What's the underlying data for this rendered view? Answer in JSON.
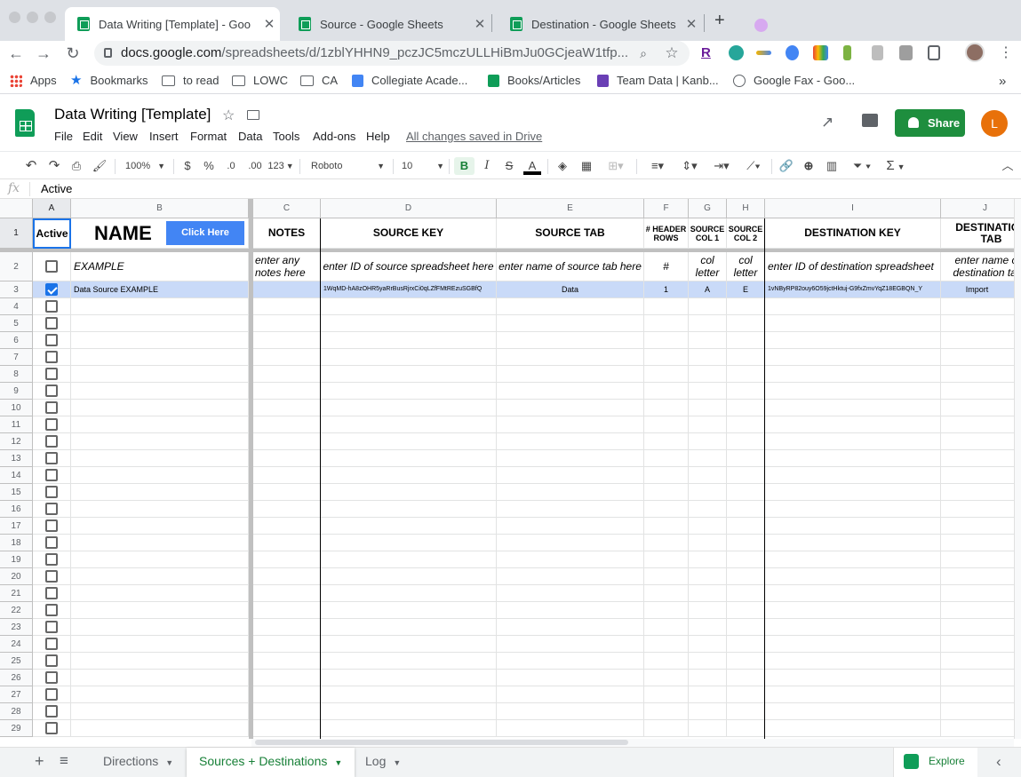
{
  "browser": {
    "tabs": [
      {
        "title": "Data Writing [Template] - Goo",
        "active": true
      },
      {
        "title": "Source - Google Sheets",
        "active": false
      },
      {
        "title": "Destination - Google Sheets",
        "active": false
      }
    ],
    "new_tab": "+",
    "close": "✕",
    "url_domain": "docs.google.com",
    "url_path": "/spreadsheets/d/1zblYHHN9_pczJC5mczULLHiBmJu0GCjeaW1tfp...",
    "bookmarks": [
      "Apps",
      "Bookmarks",
      "to read",
      "LOWC",
      "CA",
      "Collegiate Acade...",
      "Books/Articles",
      "Team Data | Kanb...",
      "Google Fax - Goo..."
    ],
    "bookmarks_more": "»",
    "ext_r_label": "R"
  },
  "app": {
    "title": "Data Writing [Template]",
    "menu": [
      "File",
      "Edit",
      "View",
      "Insert",
      "Format",
      "Data",
      "Tools",
      "Add-ons",
      "Help"
    ],
    "save_status": "All changes saved in Drive",
    "share_label": "Share",
    "avatar_initial": "L",
    "accent_color": "#1e8e3e"
  },
  "toolbar": {
    "zoom": "100%",
    "currency": "$",
    "percent": "%",
    "dec_less": ".0",
    "dec_more": ".00",
    "more_formats": "123",
    "font": "Roboto",
    "font_size": "10",
    "bold": "B",
    "italic": "I",
    "strike": "S",
    "text_color": "A",
    "sum": "Σ"
  },
  "formula_bar": {
    "fx": "fx",
    "value": "Active"
  },
  "grid": {
    "columns": [
      "A",
      "B",
      "C",
      "D",
      "E",
      "F",
      "G",
      "H",
      "I",
      "J"
    ],
    "header_row": {
      "a": "Active",
      "b": "NAME",
      "b_button": "Click Here",
      "c": "NOTES",
      "d": "SOURCE KEY",
      "e": "SOURCE TAB",
      "f": "# HEADER ROWS",
      "g": "SOURCE COL 1",
      "h": "SOURCE COL 2",
      "i": "DESTINATION KEY",
      "j": "DESTINATION TAB"
    },
    "example_row": {
      "b": "EXAMPLE",
      "c": "enter any notes here",
      "d": "enter ID of source spreadsheet here",
      "e": "enter name of source tab here",
      "f": "#",
      "g": "col letter",
      "h": "col letter",
      "i": "enter ID of destination spreadsheet",
      "j": "enter name of destination tab"
    },
    "data_row": {
      "a_checked": true,
      "b": "Data Source EXAMPLE",
      "c": "",
      "d": "1WqMD-hA8zOHR5yaRrBusRjrxCi0qLZfFMtREzuSGBfQ",
      "e": "Data",
      "f": "1",
      "g": "A",
      "h": "E",
      "i": "1vNByRP82ouy6O59jctHktuj-G9fxZmvYqZ18EGBQN_Y",
      "j": "Import"
    },
    "row_numbers": [
      "1",
      "2",
      "3",
      "4",
      "5",
      "6",
      "7",
      "8",
      "9",
      "10",
      "11",
      "12",
      "13",
      "14",
      "15",
      "16",
      "17",
      "18",
      "19",
      "20",
      "21",
      "22",
      "23",
      "24",
      "25",
      "26",
      "27",
      "28",
      "29"
    ]
  },
  "sheet_tabs": {
    "add": "+",
    "list": "≡",
    "tabs": [
      {
        "label": "Directions",
        "active": false
      },
      {
        "label": "Sources + Destinations",
        "active": true
      },
      {
        "label": "Log",
        "active": false
      }
    ],
    "explore": "Explore",
    "collapse": "‹"
  }
}
